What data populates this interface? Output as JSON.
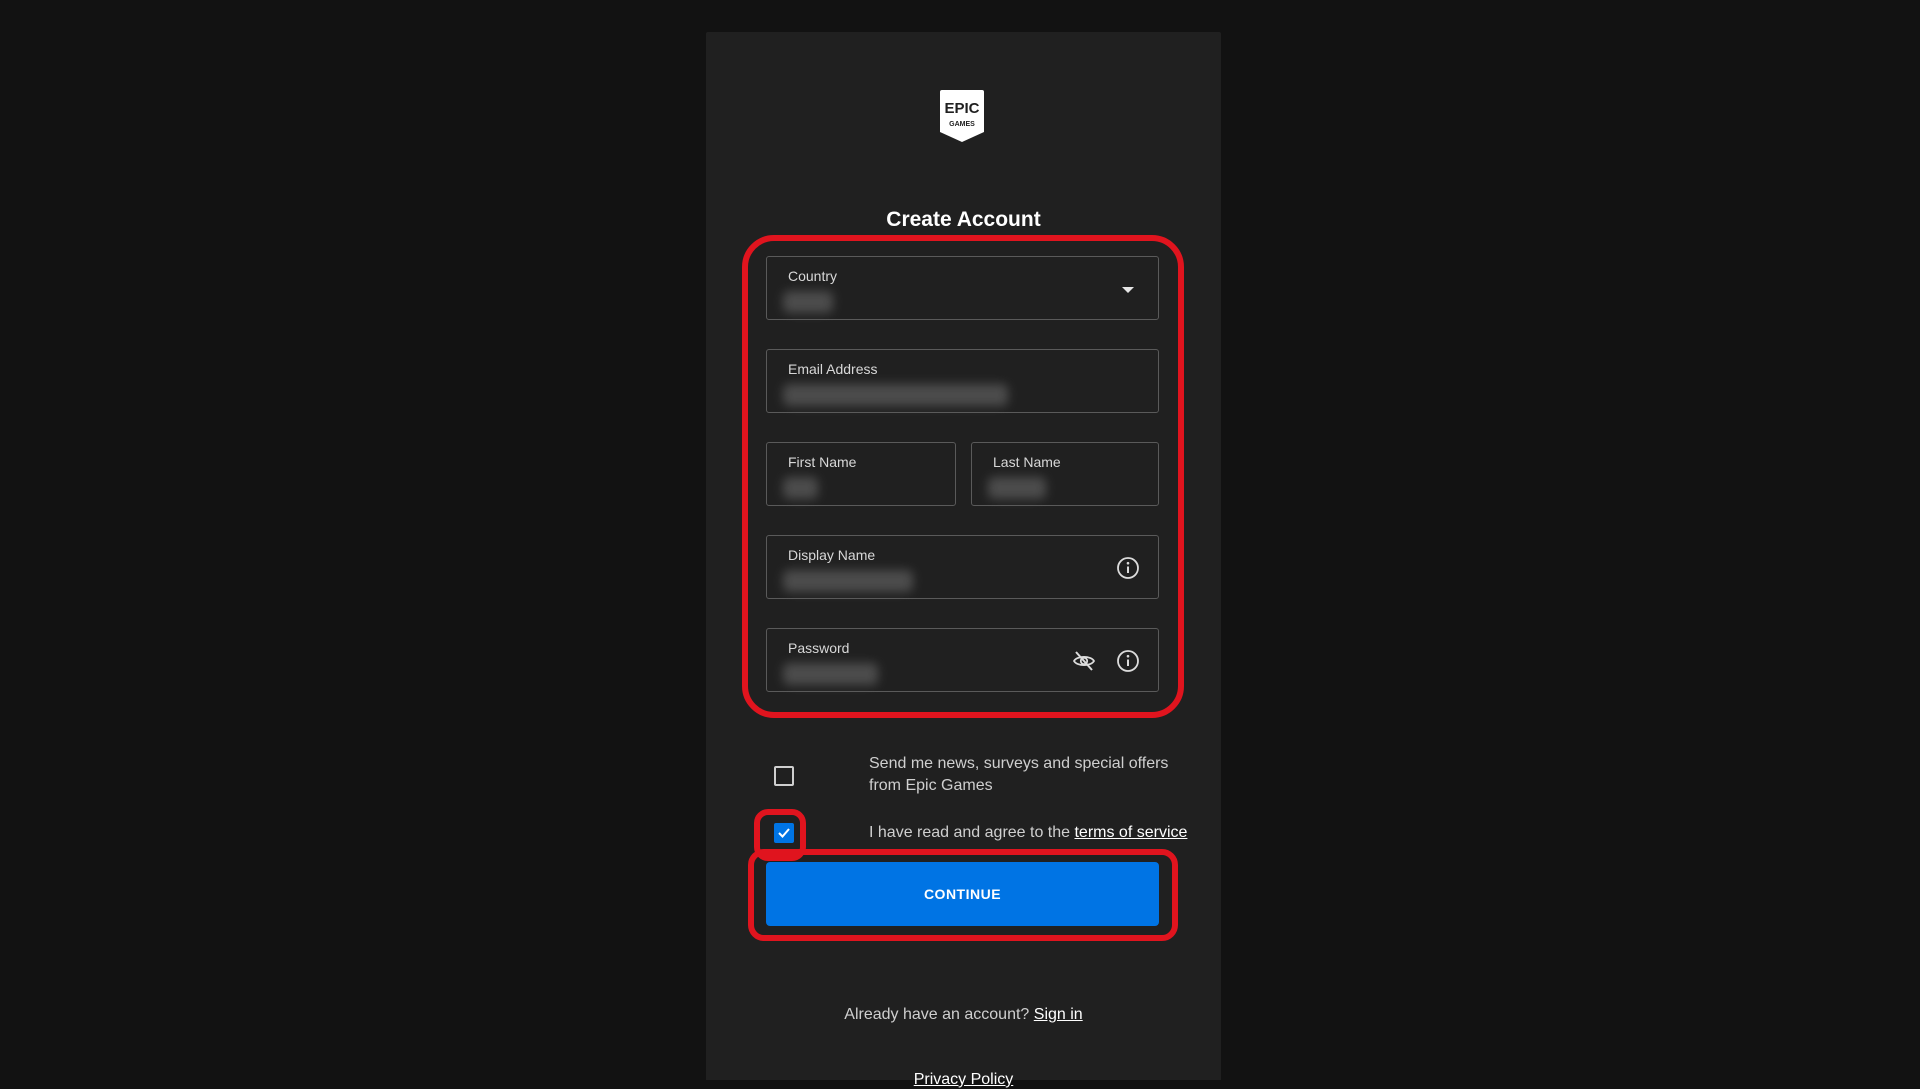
{
  "logo": {
    "line1": "EPIC",
    "line2": "GAMES"
  },
  "title": "Create Account",
  "form": {
    "country": {
      "label": "Country",
      "value": ""
    },
    "email": {
      "label": "Email Address",
      "value": ""
    },
    "first_name": {
      "label": "First Name",
      "value": ""
    },
    "last_name": {
      "label": "Last Name",
      "value": ""
    },
    "display_name": {
      "label": "Display Name",
      "value": ""
    },
    "password": {
      "label": "Password",
      "value": ""
    }
  },
  "checkboxes": {
    "newsletter": {
      "line1": "Send me news, surveys and special offers",
      "line2": "from Epic Games",
      "checked": false
    },
    "terms": {
      "prefix": "I have read and agree to the ",
      "link": "terms of service",
      "checked": true
    }
  },
  "continue_label": "CONTINUE",
  "signin": {
    "prompt": "Already have an account?",
    "link": "Sign in"
  },
  "privacy_link": "Privacy Policy",
  "colors": {
    "background": "#121212",
    "panel": "#202020",
    "accent": "#0074e4",
    "highlight": "#e0141e"
  },
  "icons": {
    "dropdown": "chevron-down-icon",
    "info": "info-icon",
    "visibility": "eye-off-icon",
    "checkmark": "check-icon"
  }
}
